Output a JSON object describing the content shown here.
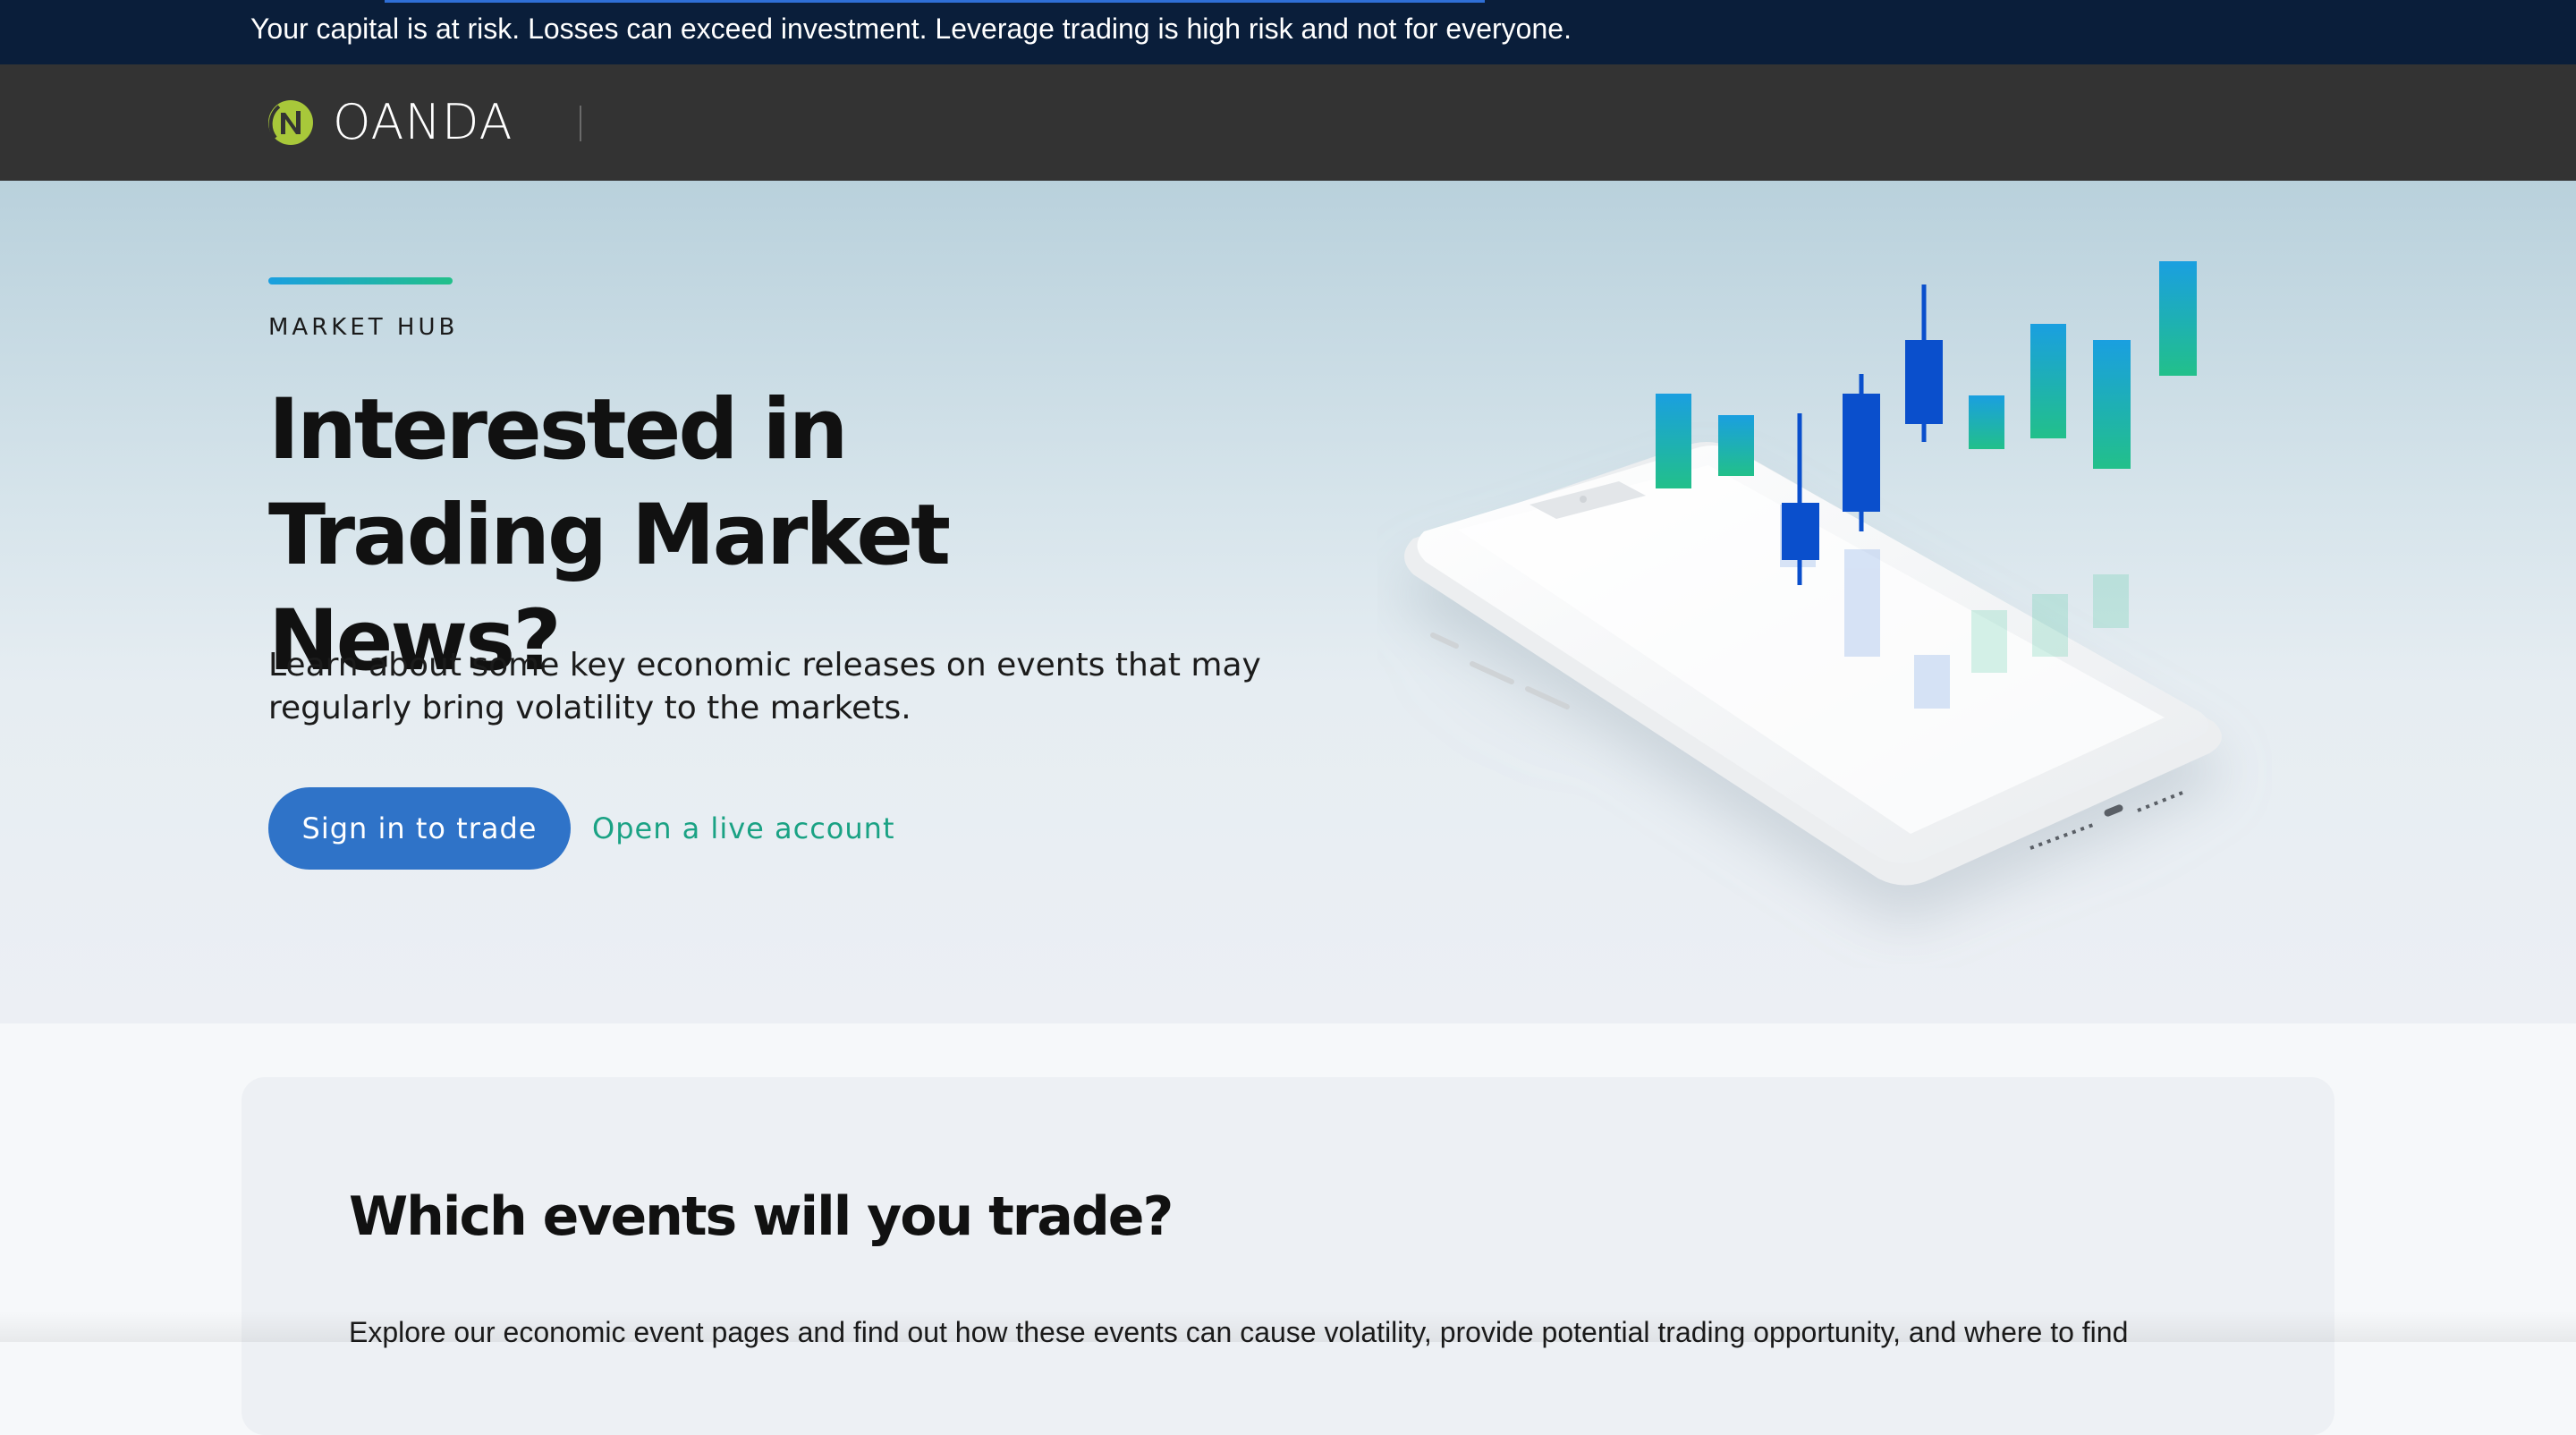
{
  "risk_banner": {
    "text": "Your capital is at risk. Losses can exceed investment. Leverage trading is high risk and not for everyone."
  },
  "navbar": {
    "logo_text": "OANDA",
    "logo_icon": "oanda-logo-icon"
  },
  "hero": {
    "eyebrow": "MARKET HUB",
    "title": "Interested in Trading Market News?",
    "description": "Learn about some key economic releases on events that may regularly bring volatility to the markets.",
    "primary_button": "Sign in to trade",
    "secondary_link": "Open a live account",
    "illustration": "smartphone-candlestick-chart-illustration"
  },
  "events": {
    "title": "Which events will you trade?",
    "description": "Explore our economic event pages and find out how these events can cause volatility, provide potential trading opportunity, and where to find"
  },
  "colors": {
    "banner_bg": "#0a1e3a",
    "nav_bg": "#333333",
    "logo_green": "#a8c83a",
    "primary_button": "#2f73c8",
    "link_green": "#1aa284",
    "accent_blue": "#1a9fe0",
    "accent_green": "#22c08a"
  }
}
